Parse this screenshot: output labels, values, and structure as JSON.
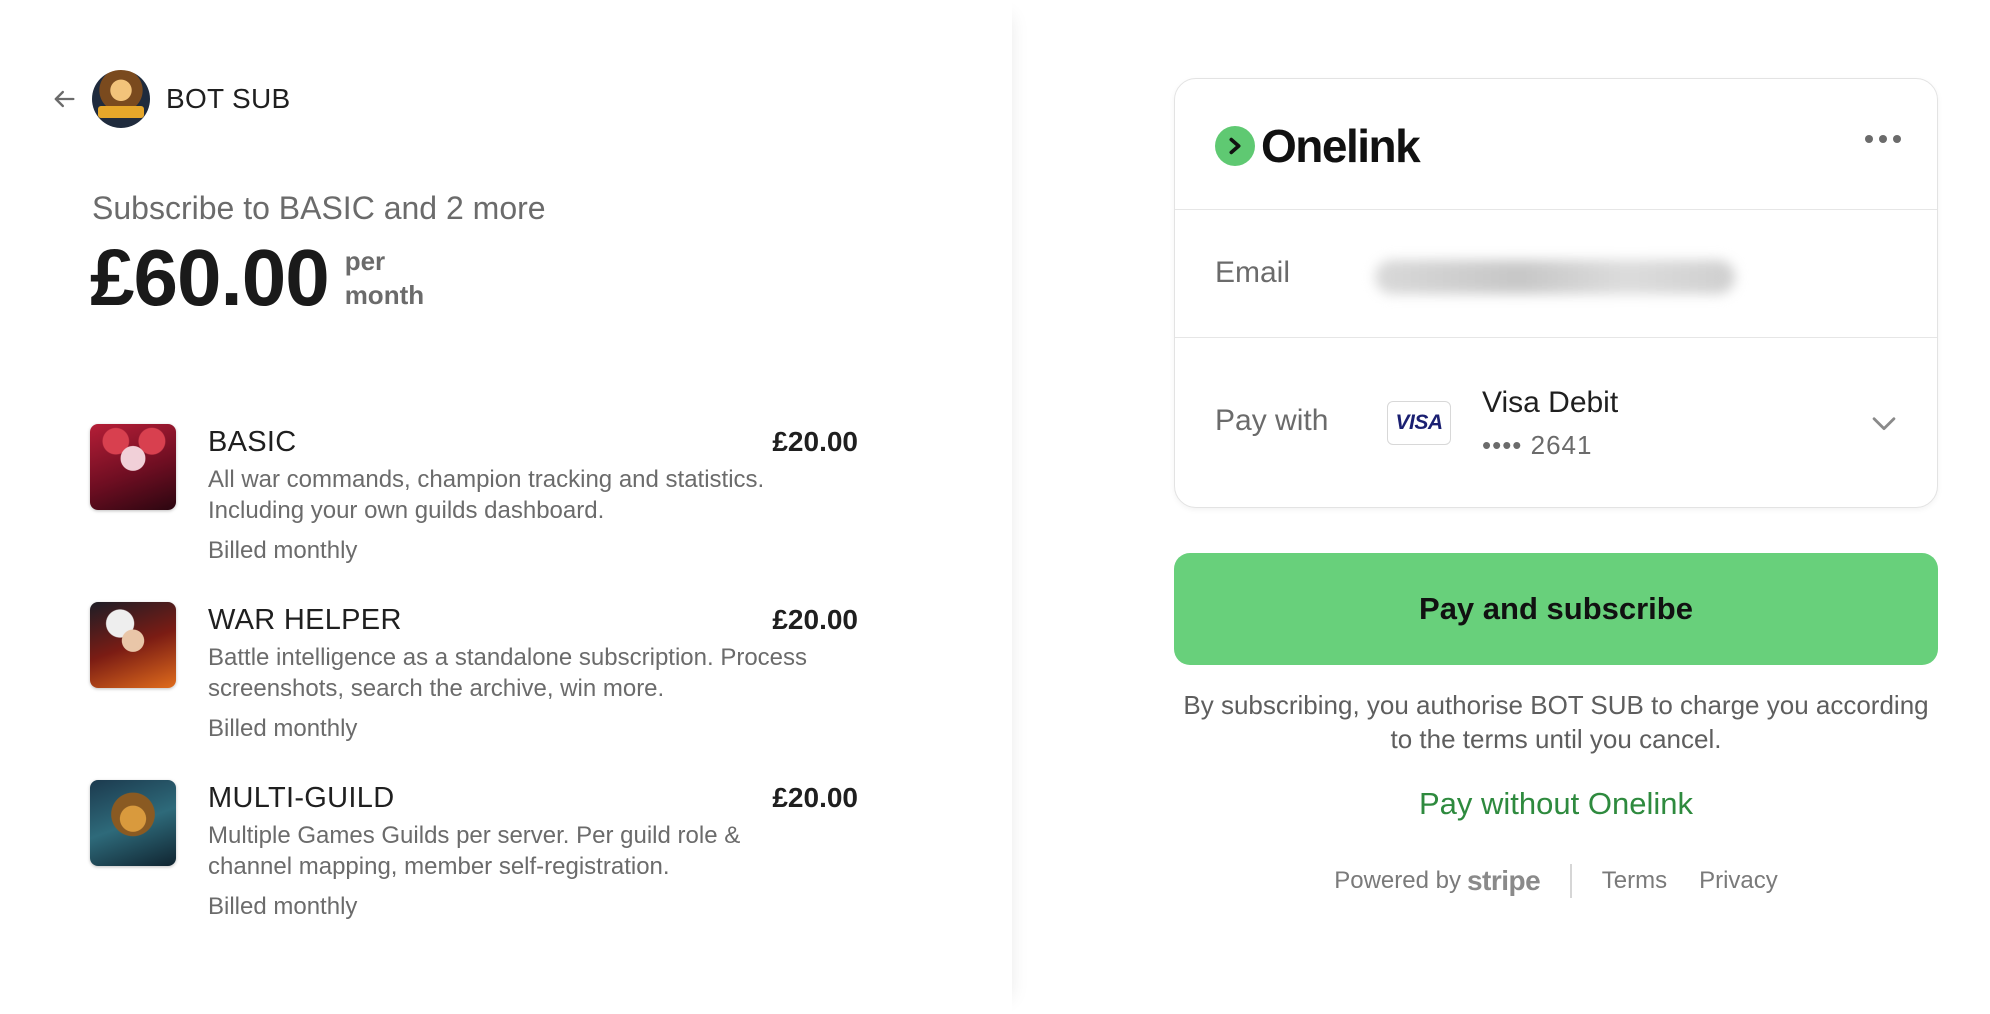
{
  "merchant": {
    "name": "BOT SUB",
    "back_icon": "arrow-left-icon",
    "logo_icon": "merchant-logo"
  },
  "summary": {
    "title": "Subscribe to BASIC and 2 more",
    "amount": "£60.00",
    "period_line1": "per",
    "period_line2": "month"
  },
  "items": [
    {
      "name": "BASIC",
      "price": "£20.00",
      "description": "All war commands, champion tracking and statistics. Including your own guilds dashboard.",
      "billing": "Billed monthly"
    },
    {
      "name": "WAR HELPER",
      "price": "£20.00",
      "description": "Battle intelligence as a standalone subscription. Process screenshots, search the archive, win more.",
      "billing": "Billed monthly"
    },
    {
      "name": "MULTI-GUILD",
      "price": "£20.00",
      "description": "Multiple Games Guilds per server. Per guild role & channel mapping, member self-registration.",
      "billing": "Billed monthly"
    }
  ],
  "onelink": {
    "brand": "Onelink",
    "brand_icon": "chevron-right-icon",
    "menu_icon": "more-horizontal-icon",
    "email_label": "Email",
    "pay_with_label": "Pay with",
    "card_badge": "VISA",
    "card_brand": "Visa Debit",
    "card_last4": "•••• 2641",
    "dropdown_icon": "chevron-down-icon"
  },
  "actions": {
    "pay_button": "Pay and subscribe",
    "legal_text": "By subscribing, you authorise BOT SUB to charge you according to the terms until you cancel.",
    "alt_pay": "Pay without Onelink"
  },
  "footer": {
    "powered_by": "Powered by",
    "stripe": "stripe",
    "terms": "Terms",
    "privacy": "Privacy"
  },
  "colors": {
    "accent": "#68d07b",
    "link": "#2e8a3e",
    "brand_mark": "#5fc972"
  }
}
